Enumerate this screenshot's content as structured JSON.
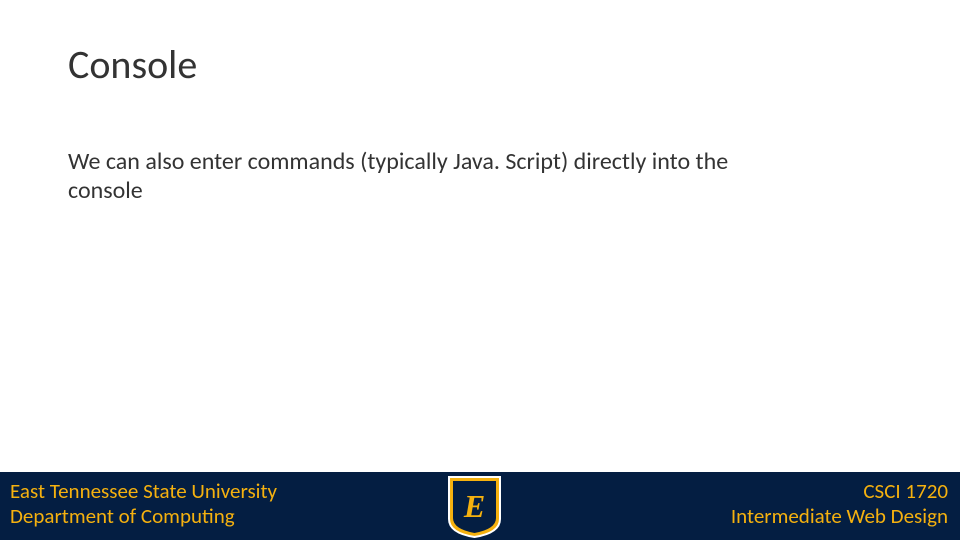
{
  "title": "Console",
  "body": "We can also enter commands (typically Java. Script) directly into the console",
  "footer": {
    "left": {
      "line1": "East Tennessee State University",
      "line2": "Department of Computing"
    },
    "right": {
      "line1": "CSCI 1720",
      "line2": "Intermediate Web Design"
    },
    "logo_letter": "E"
  },
  "colors": {
    "footer_bg": "#041e42",
    "accent_gold": "#f5b10f",
    "text": "#333333"
  }
}
